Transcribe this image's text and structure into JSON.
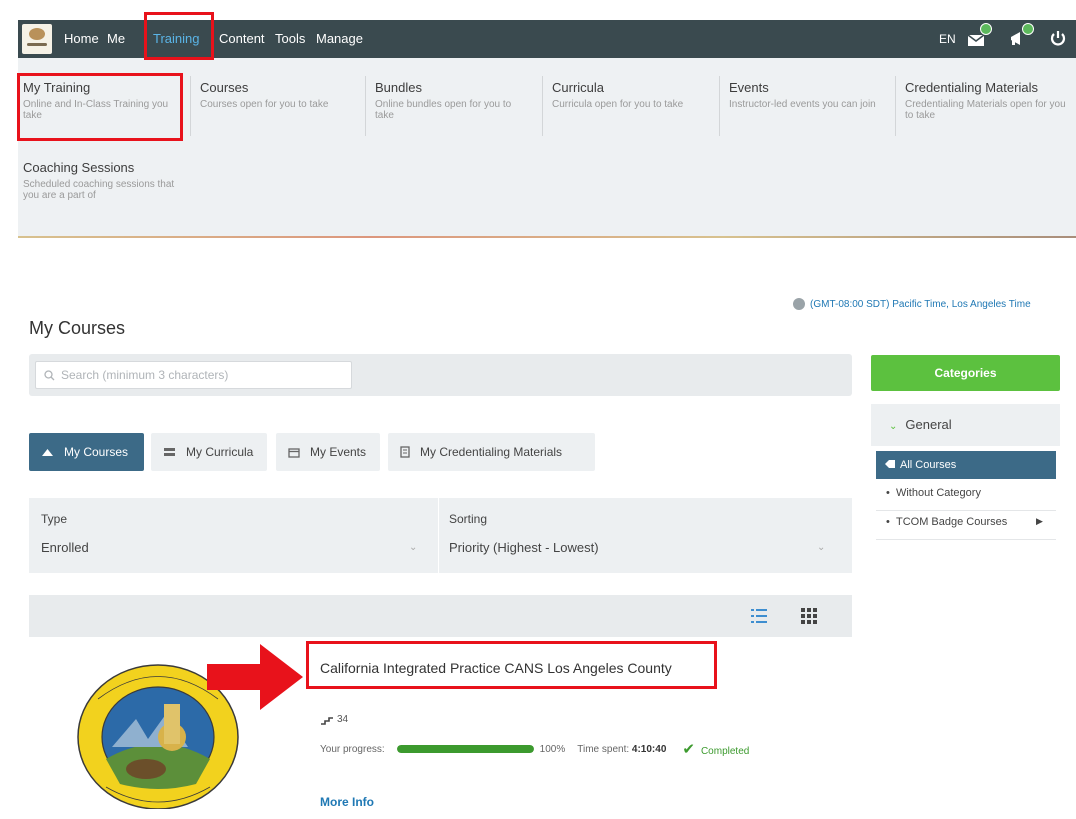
{
  "header": {
    "nav": [
      "Home",
      "Me",
      "Training",
      "Content",
      "Tools",
      "Manage"
    ],
    "active_nav": "Training",
    "language": "EN"
  },
  "megamenu": {
    "items": [
      {
        "title": "My Training",
        "desc": "Online and In-Class Training you take"
      },
      {
        "title": "Courses",
        "desc": "Courses open for you to take"
      },
      {
        "title": "Bundles",
        "desc": "Online bundles open for you to take"
      },
      {
        "title": "Curricula",
        "desc": "Curricula open for you to take"
      },
      {
        "title": "Events",
        "desc": "Instructor-led events you can join"
      },
      {
        "title": "Credentialing Materials",
        "desc": "Credentialing Materials open for you to take"
      },
      {
        "title": "Coaching Sessions",
        "desc": "Scheduled coaching sessions that you are a part of"
      }
    ]
  },
  "timezone": "(GMT-08:00 SDT) Pacific Time, Los Angeles Time",
  "page_title": "My Courses",
  "search": {
    "placeholder": "Search (minimum 3 characters)"
  },
  "tabs": [
    "My Courses",
    "My Curricula",
    "My Events",
    "My Credentialing Materials"
  ],
  "filters": {
    "type_label": "Type",
    "type_value": "Enrolled",
    "sorting_label": "Sorting",
    "sorting_value": "Priority (Highest - Lowest)"
  },
  "categories": {
    "button": "Categories",
    "group": "General",
    "items": [
      "All Courses",
      "Without Category",
      "TCOM Badge Courses"
    ]
  },
  "course": {
    "title": "California Integrated Practice CANS Los Angeles County",
    "lesson_count": "34",
    "progress_label": "Your progress:",
    "progress_value": "100%",
    "progress_fraction": 1.0,
    "time_label": "Time spent:",
    "time_value": "4:10:40",
    "status": "Completed",
    "more_info": "More Info"
  },
  "colors": {
    "topbar": "#3a4a4f",
    "active_tab": "#3c6a87",
    "categories_button": "#5cc13f",
    "highlight": "#e8121b"
  }
}
